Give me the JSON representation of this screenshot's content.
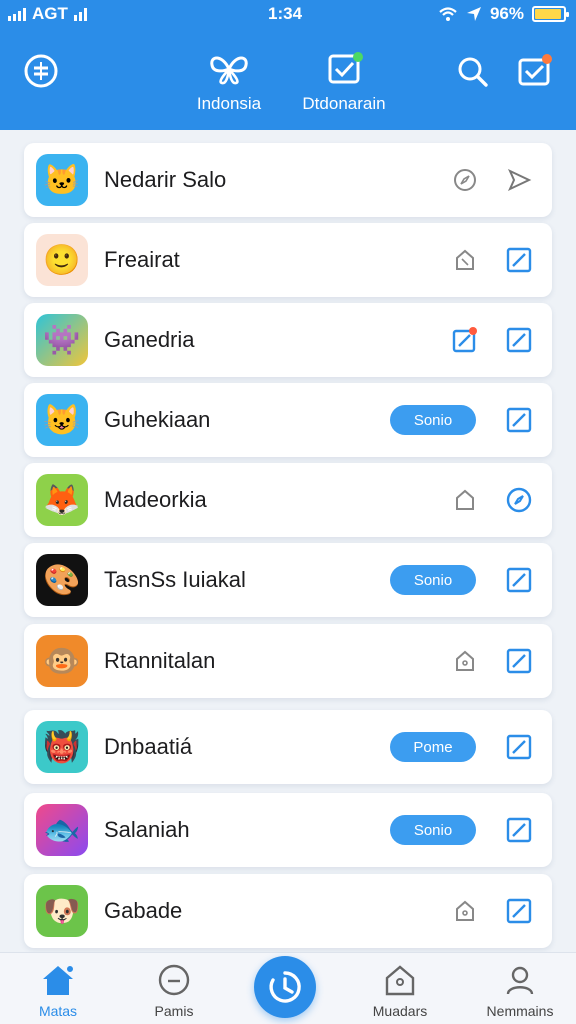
{
  "status": {
    "carrier": "AGT",
    "time": "1:34",
    "battery": "96%"
  },
  "header": {
    "nav_left_label": "Indonsia",
    "nav_right_label": "Dtdonarain"
  },
  "items": [
    {
      "title": "Nedarir Salo",
      "icon": "cat-app-icon",
      "action1": "compass-icon",
      "action2": "send-icon",
      "pill": null
    },
    {
      "title": "Freairat",
      "icon": "smiley-app-icon",
      "action1": "tag-icon",
      "action2": "edit-icon",
      "pill": null
    },
    {
      "title": "Ganedria",
      "icon": "monster-app-icon",
      "action1": "edit-icon",
      "action2": "edit-icon",
      "pill": null
    },
    {
      "title": "Guhekiaan",
      "icon": "cat-app-icon",
      "action1": null,
      "action2": "edit-icon",
      "pill": "Sonio"
    },
    {
      "title": "Madeorkia",
      "icon": "animal-app-icon",
      "action1": "tag-icon",
      "action2": "compass-icon",
      "pill": null
    },
    {
      "title": "TasnSs Iuiakal",
      "icon": "game-app-icon",
      "action1": null,
      "action2": "edit-icon",
      "pill": "Sonio"
    },
    {
      "title": "Rtannitalan",
      "icon": "creature-app-icon",
      "action1": "tag-icon",
      "action2": "edit-icon",
      "pill": null
    },
    {
      "title": "Dnbaatiá",
      "icon": "pink-monster-app-icon",
      "action1": null,
      "action2": "edit-icon",
      "pill": "Pome"
    },
    {
      "title": "Salaniah",
      "icon": "fish-app-icon",
      "action1": null,
      "action2": "edit-icon",
      "pill": "Sonio"
    },
    {
      "title": "Gabade",
      "icon": "fox-app-icon",
      "action1": "tag-icon",
      "action2": "edit-icon",
      "pill": null
    }
  ],
  "bottom_nav": {
    "home_label": "Matas",
    "pams_label": "Pamis",
    "muadars_label": "Muadars",
    "profile_label": "Nemmains"
  },
  "colors": {
    "accent": "#2b8de8",
    "pill": "#3c9df0",
    "badge_green": "#4cd964",
    "badge_orange": "#ff7a3d"
  }
}
